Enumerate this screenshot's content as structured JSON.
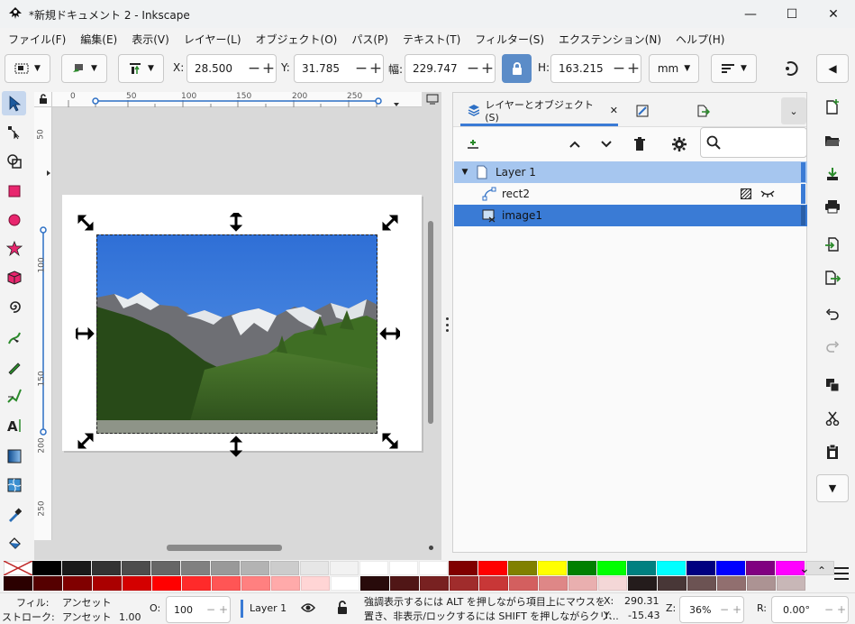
{
  "window": {
    "title": "*新規ドキュメント 2 - Inkscape",
    "minimize": "—",
    "maximize": "☐",
    "close": "✕"
  },
  "menu": [
    "ファイル(F)",
    "編集(E)",
    "表示(V)",
    "レイヤー(L)",
    "オブジェクト(O)",
    "パス(P)",
    "テキスト(T)",
    "フィルター(S)",
    "エクステンション(N)",
    "ヘルプ(H)"
  ],
  "toolbar": {
    "x_label": "X:",
    "x_value": "28.500",
    "y_label": "Y:",
    "y_value": "31.785",
    "w_label": "幅:",
    "w_value": "229.747",
    "h_label": "H:",
    "h_value": "163.215",
    "unit": "mm"
  },
  "ruler": {
    "h": [
      "0",
      "50",
      "100",
      "150",
      "200",
      "250"
    ],
    "v": [
      "50",
      "100",
      "150",
      "200",
      "250"
    ]
  },
  "panel": {
    "tabs": [
      {
        "label": "レイヤーとオブジェクト(S)",
        "close": "✕"
      }
    ],
    "layer": "Layer 1",
    "objects": [
      "rect2",
      "image1"
    ]
  },
  "palette": {
    "row1": [
      "#000000",
      "#1a1a1a",
      "#333333",
      "#4d4d4d",
      "#666666",
      "#808080",
      "#999999",
      "#b3b3b3",
      "#cccccc",
      "#e6e6e6",
      "#f2f2f2",
      "#ffffff",
      "#ffffff",
      "#ffffff",
      "#800000",
      "#ff0000",
      "#808000",
      "#ffff00",
      "#008000",
      "#00ff00",
      "#008080",
      "#00ffff",
      "#000080",
      "#0000ff",
      "#800080",
      "#ff00ff",
      "#e0e0e0"
    ],
    "row2": [
      "#2b0000",
      "#550000",
      "#800000",
      "#aa0000",
      "#d40000",
      "#ff0000",
      "#ff2a2a",
      "#ff5555",
      "#ff8080",
      "#ffaaaa",
      "#ffd5d5",
      "#ffffff",
      "#280b0b",
      "#501616",
      "#782121",
      "#a02c2c",
      "#c83737",
      "#d35f5f",
      "#de8787",
      "#e9afaf",
      "#f4d7d7",
      "#241c1c",
      "#483737",
      "#6c5353",
      "#916f6f",
      "#ac9393",
      "#c8b7b7"
    ]
  },
  "status": {
    "fill_label": "フィル:",
    "fill_value": "アンセット",
    "stroke_label": "ストローク:",
    "stroke_value": "アンセット",
    "stroke_width": "1.00",
    "opacity_label": "O:",
    "opacity_value": "100",
    "layer": "Layer 1",
    "message_line1": "強調表示するには ALT を押しながら項目上にマウスを",
    "message_line2": "置き、非表示/ロックするには SHIFT を押しながらクリ...",
    "x_label": "X:",
    "x_value": "290.31",
    "y_label": "Y:",
    "y_value": "-15.43",
    "zoom_label": "Z:",
    "zoom_value": "36%",
    "rotate_label": "R:",
    "rotate_value": "0.00°"
  }
}
